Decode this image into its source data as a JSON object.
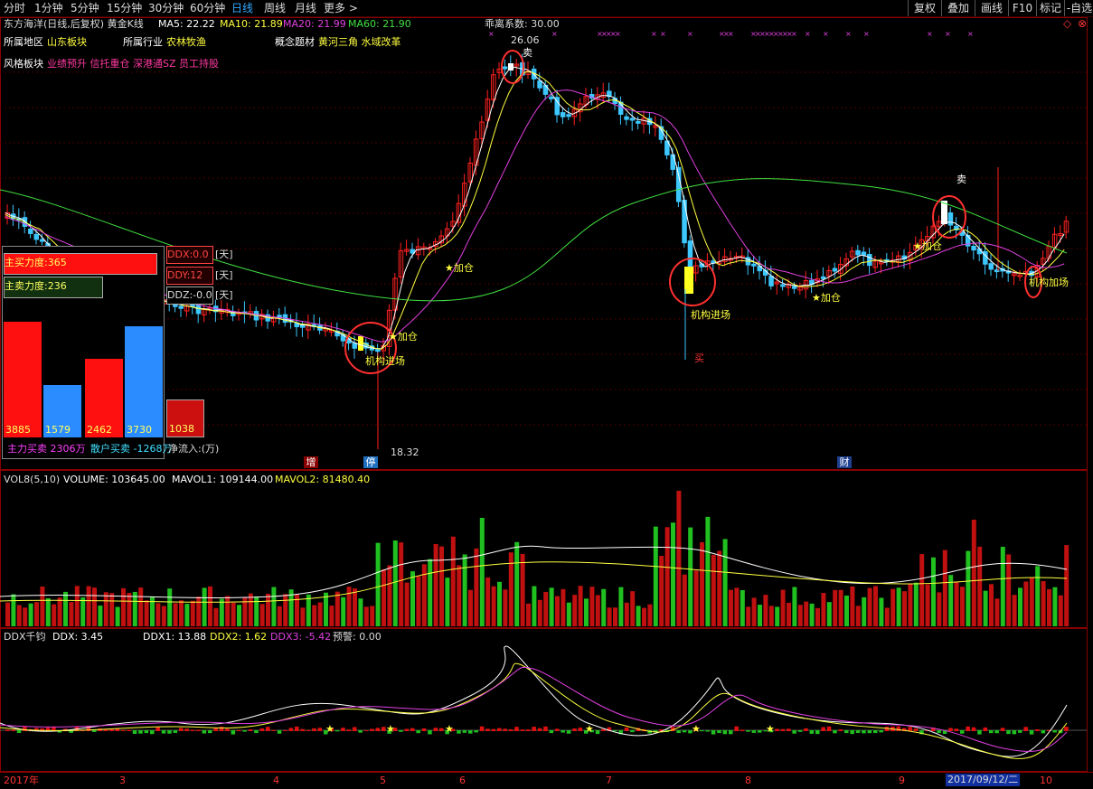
{
  "toolbar": {
    "periods": [
      "分时",
      "1分钟",
      "5分钟",
      "15分钟",
      "30分钟",
      "60分钟",
      "日线",
      "周线",
      "月线",
      "更多 >"
    ],
    "active": "日线",
    "right": [
      "复权",
      "叠加",
      "画线",
      "F10",
      "标记",
      "-自选"
    ]
  },
  "header": {
    "stock_label": "东方海洋(日线,后复权) 黄金K线",
    "ma5": "MA5: 22.22",
    "ma10": "MA10: 21.89",
    "ma20": "MA20: 21.99",
    "ma60": "MA60: 21.90",
    "deviation": "乖离系数: 30.00",
    "region_label": "所属地区",
    "region_value": "山东板块",
    "industry_label": "所属行业",
    "industry_value": "农林牧渔",
    "concept_label": "概念题材",
    "concept_value": "黄河三角 水域改革",
    "style_label": "风格板块",
    "style_value": "业绩预升 信托重仓 深港通SZ 员工持股"
  },
  "annotations": {
    "high_price": "26.06",
    "low_price": "18.32",
    "sell": "卖",
    "buy": "买",
    "add": "加仓",
    "inst_enter": "机构进场",
    "inst_add": "机构加场",
    "event_zeng": "增",
    "event_ting": "停",
    "event_cai": "财"
  },
  "ddx_box": {
    "main_buy_label": "主买力度:365",
    "main_sell_label": "主卖力度:236",
    "ddx": "DDX:0.0",
    "ddy": "DDY:12",
    "ddz": "DDZ:-0.0",
    "day_unit": "[天]",
    "bars": [
      {
        "value": "3885",
        "color": "#ff1010",
        "level": 1.0
      },
      {
        "value": "1579",
        "color": "#2a8cff",
        "level": 0.45
      },
      {
        "value": "2462",
        "color": "#ff1010",
        "level": 0.68
      },
      {
        "value": "3730",
        "color": "#2a8cff",
        "level": 0.96
      },
      {
        "value": "1038",
        "color": "#cc1010",
        "level": 0.33
      }
    ],
    "footer_main": "主力买卖 2306万",
    "footer_retail": "散户买卖 -1268万",
    "footer_net": "净流入:(万)"
  },
  "volume_panel": {
    "label": "VOL8(5,10)",
    "volume": "VOLUME: 103645.00",
    "mavol1": "MAVOL1: 109144.00",
    "mavol2": "MAVOL2: 81480.40"
  },
  "ddx_panel": {
    "label": "DDX千钧",
    "ddx": "DDX: 3.45",
    "ddx1": "DDX1: 13.88",
    "ddx2": "DDX2: 1.62",
    "ddx3": "DDX3: -5.42",
    "warn": "预警: 0.00"
  },
  "date_axis": {
    "labels": [
      "2017年",
      "3",
      "4",
      "5",
      "6",
      "7",
      "8",
      "9",
      "10"
    ],
    "highlight": "2017/09/12/二"
  },
  "colors": {
    "up": "#ff2020",
    "down": "#3cc8ff",
    "ma5": "#ffffff",
    "ma10": "#ffff40",
    "ma20": "#e040e0",
    "ma60": "#40e040",
    "border": "#8a0000"
  }
}
